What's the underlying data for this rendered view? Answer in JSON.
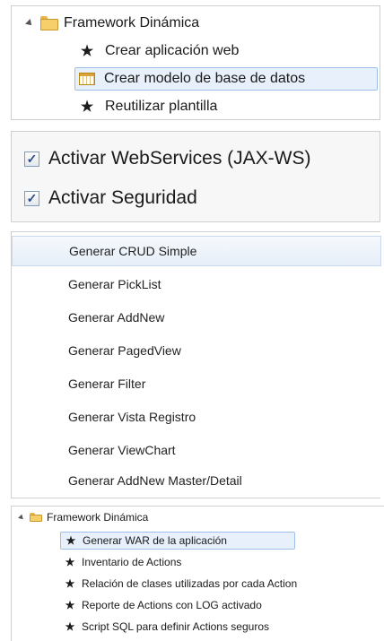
{
  "panel_tree_top": {
    "root_label": "Framework Dinámica",
    "items": [
      {
        "label": "Crear aplicación web",
        "icon": "run-icon"
      },
      {
        "label": "Crear modelo de base de datos",
        "icon": "table-icon",
        "selected": true
      },
      {
        "label": "Reutilizar plantilla",
        "icon": "run-icon"
      }
    ]
  },
  "panel_checkboxes": {
    "items": [
      {
        "label": "Activar WebServices (JAX-WS)",
        "checked": true
      },
      {
        "label": "Activar Seguridad",
        "checked": true
      }
    ]
  },
  "panel_menu": {
    "items": [
      "Generar CRUD Simple",
      "Generar PickList",
      "Generar AddNew",
      "Generar PagedView",
      "Generar Filter",
      "Generar Vista Registro",
      "Generar ViewChart",
      "Generar AddNew Master/Detail"
    ],
    "highlighted_index": 0
  },
  "panel_tree_bottom": {
    "root_label": "Framework Dinámica",
    "items": [
      {
        "label": "Generar WAR de la aplicación",
        "selected": true
      },
      {
        "label": "Inventario de Actions"
      },
      {
        "label": "Relación de clases utilizadas por cada Action"
      },
      {
        "label": "Reporte de Actions con LOG activado"
      },
      {
        "label": "Script SQL para definir Actions seguros"
      }
    ]
  }
}
